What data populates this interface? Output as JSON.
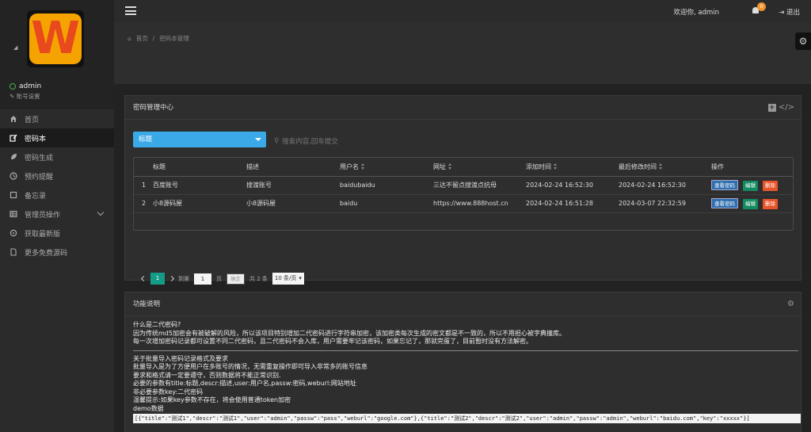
{
  "sidebar": {
    "logo_letter": "W",
    "user": {
      "name": "admin",
      "account_settings": "账号设置"
    },
    "items": [
      {
        "label": "首页",
        "icon": "home-icon"
      },
      {
        "label": "密码本",
        "icon": "edit-icon",
        "active": true
      },
      {
        "label": "密码生成",
        "icon": "leaf-icon"
      },
      {
        "label": "预约提醒",
        "icon": "clock-icon"
      },
      {
        "label": "备忘录",
        "icon": "note-icon"
      },
      {
        "label": "管理员操作",
        "icon": "table-icon",
        "has_submenu": true
      },
      {
        "label": "获取最新版",
        "icon": "refresh-icon"
      },
      {
        "label": "更多免费源码",
        "icon": "file-icon"
      }
    ]
  },
  "topbar": {
    "welcome": "欢迎你, admin",
    "notification_count": "0",
    "logout": "退出"
  },
  "breadcrumb": {
    "home": "首页",
    "separator": "/",
    "current": "密码本管理"
  },
  "panel_passwords": {
    "title": "密码管理中心",
    "select_value": "标题",
    "search_placeholder": "搜索内容,回车提交",
    "columns": [
      "",
      "标题",
      "描述",
      "用户名",
      "网址",
      "添加时间",
      "最后修改时间",
      "操作"
    ],
    "rows": [
      {
        "idx": "1",
        "title": "百度账号",
        "descr": "搜渡账号",
        "user": "baidubaidu",
        "url": "三达不留点搜渡点抗母",
        "added": "2024-02-24 16:52:30",
        "modified": "2024-02-24 16:52:30"
      },
      {
        "idx": "2",
        "title": "小8源码屋",
        "descr": "小8源码屋",
        "user": "baidu",
        "url": "https://www.888host.cn",
        "added": "2024-02-24 16:51:28",
        "modified": "2024-03-07 22:32:59"
      }
    ],
    "actions": {
      "view": "查看密码",
      "edit": "编辑",
      "delete": "删除"
    },
    "pager": {
      "current": "1",
      "goto": "到第",
      "goto_value": "1",
      "page_unit": "页",
      "confirm": "确定",
      "total": "共 2 条",
      "per_page": "10 条/页"
    }
  },
  "panel_help": {
    "title": "功能说明",
    "lines1": [
      "什么是二代密码?",
      "因为传统md5加密会有被破解的风险，所以该项目特别增加二代密码进行字符串加密，该加密类每次生成的密文都是不一致的，所以不用担心被字典撞库。",
      "每一次增加密码记录都可设置不同二代密码，且二代密码不会入库，用户需要牢记该密码，如果忘记了，那就完蛋了，目前暂时没有方法解密。"
    ],
    "lines2": [
      "关于批量导入密码记录格式及要求",
      "批量导入是为了方便用户在多账号的情况，无需重复操作即可导入非常多的账号信息",
      "要求和格式请一定要遵守，否则数据将不能正常识别.",
      "必要的参数有title:标题,descr:描述,user:用户名,passw:密码,weburl:网站地址",
      "非必要参数key:二代密码",
      "温馨提示:如果key参数不存在，将会使用普通token加密",
      "demo数据"
    ],
    "demo": "[{\"title\":\"测试1\",\"descr\":\"测试1\",\"user\":\"admin\",\"passw\":\"pass\",\"weburl\":\"google.com\"},{\"title\":\"测试2\",\"descr\":\"测试2\",\"user\":\"admin\",\"passw\":\"admin\",\"weburl\":\"baidu.com\",\"key\":\"xxxxx\"}]"
  }
}
